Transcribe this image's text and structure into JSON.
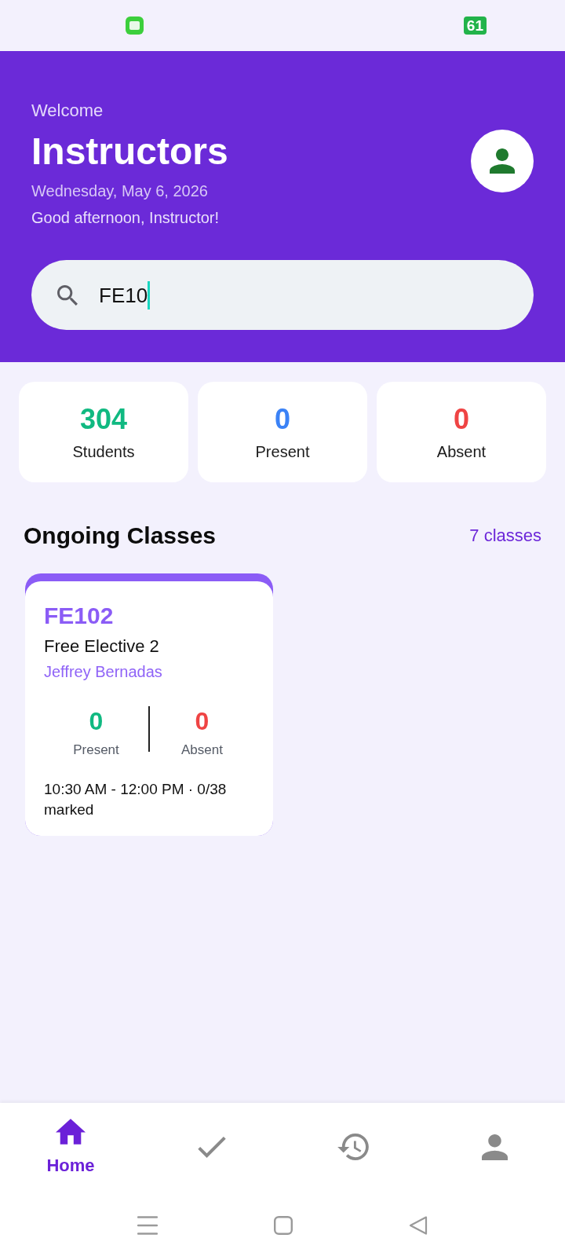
{
  "status_bar": {
    "battery": "61"
  },
  "header": {
    "welcome": "Welcome",
    "title": "Instructors",
    "date": "Wednesday, May 6, 2026",
    "greeting": "Good afternoon, Instructor!"
  },
  "search": {
    "value": "FE10"
  },
  "stats": [
    {
      "value": "304",
      "label": "Students",
      "color": "#10b981"
    },
    {
      "value": "0",
      "label": "Present",
      "color": "#3b82f6"
    },
    {
      "value": "0",
      "label": "Absent",
      "color": "#ef4444"
    }
  ],
  "section": {
    "title": "Ongoing Classes",
    "count": "7 classes"
  },
  "classes": [
    {
      "code": "FE102",
      "name": "Free Elective 2",
      "instructor": "Jeffrey Bernadas",
      "counts": [
        {
          "value": "0",
          "label": "Present",
          "color": "#10b981"
        },
        {
          "value": "0",
          "label": "Absent",
          "color": "#ef4444"
        }
      ],
      "schedule": "10:30 AM - 12:00 PM · 0/38 marked"
    }
  ],
  "bottom_nav": [
    {
      "label": "Home",
      "selected": true
    },
    {
      "selected": false
    },
    {
      "selected": false
    },
    {
      "selected": false
    }
  ]
}
